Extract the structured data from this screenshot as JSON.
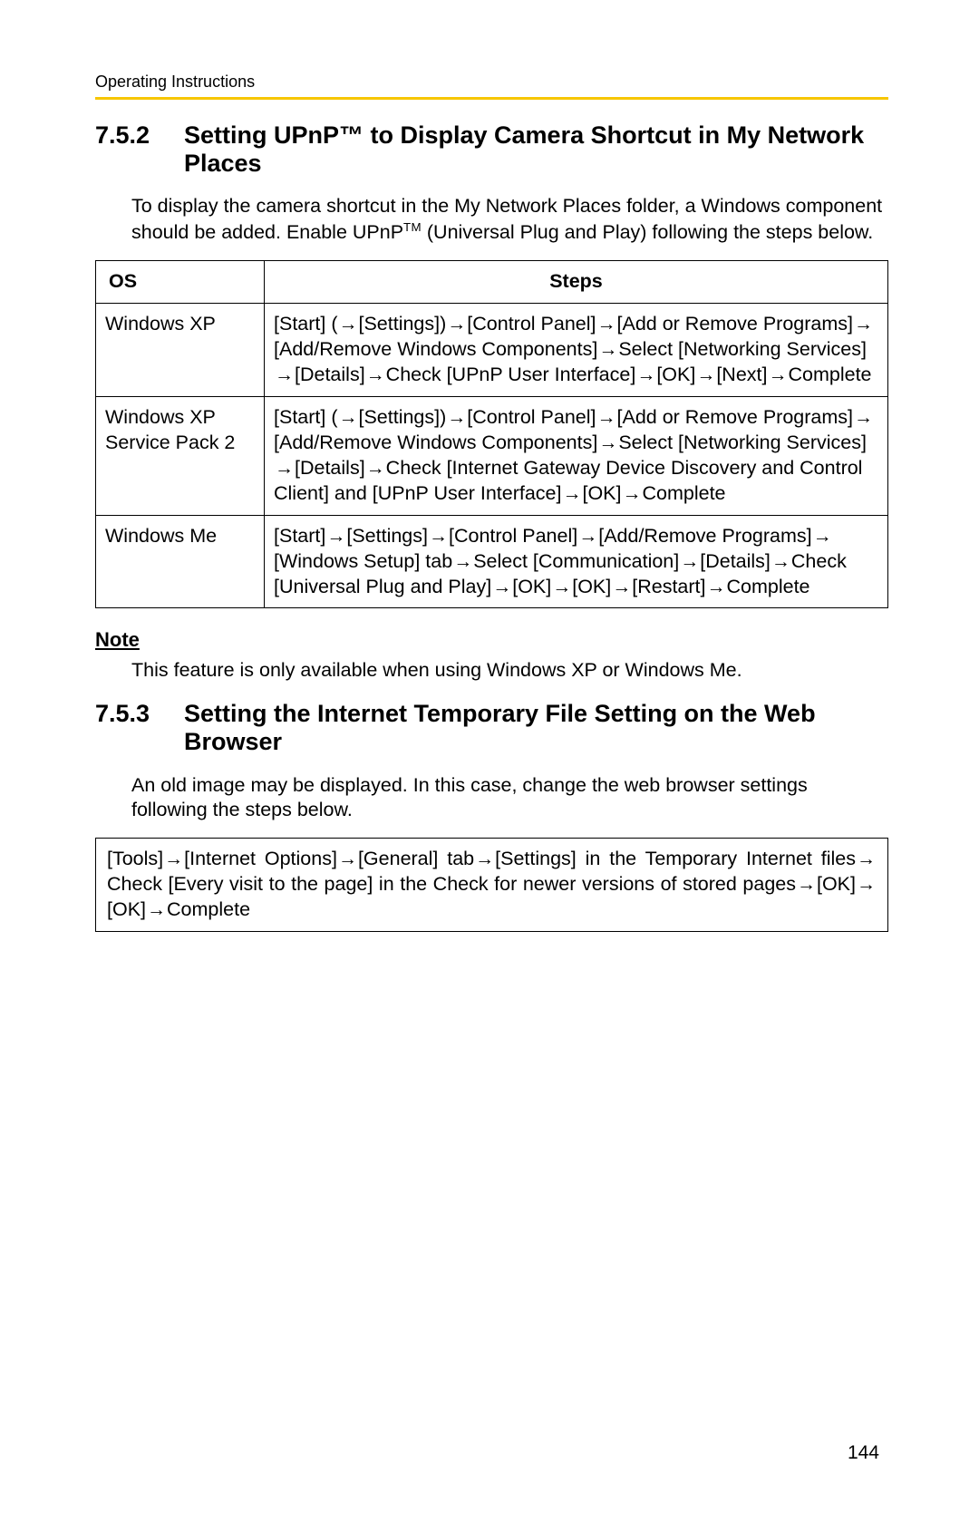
{
  "header": {
    "running_title": "Operating Instructions"
  },
  "section752": {
    "number": "7.5.2",
    "title_part1": "Setting UPnP™ to Display Camera Shortcut in My Network Places",
    "intro_pre": "To display the camera shortcut in the My Network Places folder, a Windows component should be added. Enable UPnP",
    "intro_post": " (Universal Plug and Play) following the steps below.",
    "table": {
      "head_os": "OS",
      "head_steps": "Steps",
      "rows": [
        {
          "os": "Windows XP",
          "steps_tokens": [
            "[Start] (",
            "→",
            "[Settings])",
            "→",
            "[Control Panel]",
            "→",
            "[Add or Remove Programs]",
            "→",
            "[Add/Remove Windows Components]",
            "→",
            "Select [Networking Services]",
            "→",
            "[Details]",
            "→",
            "Check [UPnP User Interface]",
            "→",
            "[OK]",
            "→",
            "[Next]",
            "→",
            "Complete"
          ]
        },
        {
          "os": "Windows XP Service Pack 2",
          "steps_tokens": [
            "[Start] (",
            "→",
            "[Settings])",
            "→",
            "[Control Panel]",
            "→",
            "[Add or Remove Programs]",
            "→",
            "[Add/Remove Windows Components]",
            "→",
            "Select [Networking Services]",
            "→",
            "[Details]",
            "→",
            "Check [Internet Gateway Device Discovery and Control Client] and [UPnP User Interface]",
            "→",
            "[OK]",
            "→",
            "Complete"
          ]
        },
        {
          "os": "Windows Me",
          "steps_tokens": [
            "[Start]",
            "→",
            "[Settings]",
            "→",
            "[Control Panel]",
            "→",
            "[Add/Remove Programs]",
            "→",
            "[Windows Setup] tab",
            "→",
            "Select [Communication]",
            "→",
            "[Details]",
            "→",
            "Check [Universal Plug and Play]",
            "→",
            "[OK]",
            "→",
            "[OK]",
            "→",
            "[Restart]",
            "→",
            "Complete"
          ]
        }
      ]
    },
    "note_label": "Note",
    "note_text": "This feature is only available when using Windows XP or Windows Me."
  },
  "section753": {
    "number": "7.5.3",
    "title": "Setting the Internet Temporary File Setting on the Web Browser",
    "intro": "An old image may be displayed. In this case, change the web browser settings following the steps below.",
    "box_tokens": [
      "[Tools]",
      "→",
      "[Internet Options]",
      "→",
      "[General] tab",
      "→",
      "[Settings] in the Temporary Internet files",
      "→",
      "Check [Every visit to the page] in the Check for newer versions of stored pages",
      "→",
      "[OK]",
      "→",
      "[OK]",
      "→",
      "Complete"
    ]
  },
  "page_number": "144",
  "glyphs": {
    "arrow": "→",
    "tm": "TM"
  }
}
